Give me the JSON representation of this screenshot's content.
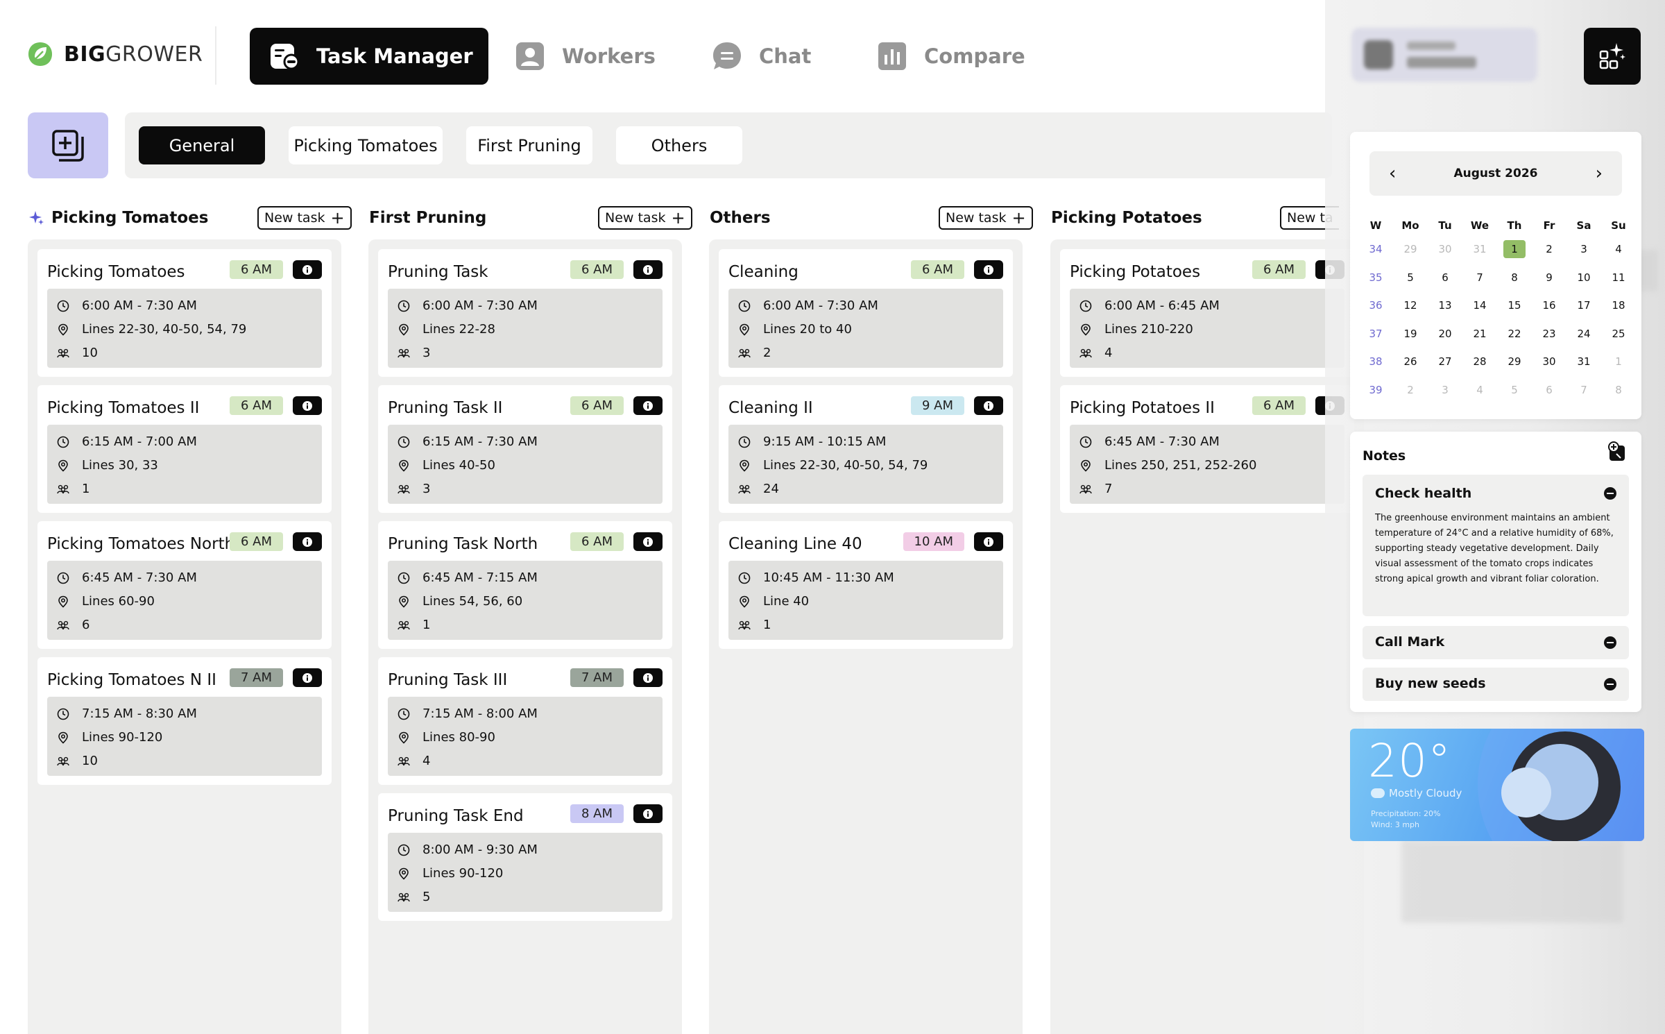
{
  "brand": {
    "bold": "BIG",
    "light": "GROWER"
  },
  "nav": [
    {
      "label": "Task Manager",
      "active": true
    },
    {
      "label": "Workers",
      "active": false
    },
    {
      "label": "Chat",
      "active": false
    },
    {
      "label": "Compare",
      "active": false
    }
  ],
  "tabs": [
    {
      "label": "General",
      "active": true
    },
    {
      "label": "Picking Tomatoes",
      "active": false
    },
    {
      "label": "First Pruning",
      "active": false
    },
    {
      "label": "Others",
      "active": false
    }
  ],
  "new_task_label": "New task",
  "new_task_label_cut": "New ta",
  "columns": [
    {
      "title": "Picking Tomatoes",
      "cards": [
        {
          "title": "Picking Tomatoes",
          "badge": "6 AM",
          "time": "6:00 AM - 7:30 AM",
          "lines": "Lines 22-30, 40-50, 54, 79",
          "workers": "10"
        },
        {
          "title": "Picking Tomatoes II",
          "badge": "6 AM",
          "time": "6:15 AM - 7:00 AM",
          "lines": "Lines 30, 33",
          "workers": "1"
        },
        {
          "title": "Picking Tomatoes North",
          "badge": "6 AM",
          "time": "6:45 AM - 7:30 AM",
          "lines": "Lines 60-90",
          "workers": "6"
        },
        {
          "title": "Picking Tomatoes N II",
          "badge": "7 AM",
          "time": "7:15 AM - 8:30 AM",
          "lines": "Lines 90-120",
          "workers": "10"
        }
      ]
    },
    {
      "title": "First Pruning",
      "cards": [
        {
          "title": "Pruning Task",
          "badge": "6 AM",
          "time": "6:00 AM - 7:30 AM",
          "lines": "Lines 22-28",
          "workers": "3"
        },
        {
          "title": "Pruning Task II",
          "badge": "6 AM",
          "time": "6:15 AM - 7:30 AM",
          "lines": "Lines 40-50",
          "workers": "3"
        },
        {
          "title": "Pruning Task North",
          "badge": "6 AM",
          "time": "6:45 AM - 7:15 AM",
          "lines": "Lines 54, 56, 60",
          "workers": "1"
        },
        {
          "title": "Pruning Task III",
          "badge": "7 AM",
          "time": "7:15 AM - 8:00 AM",
          "lines": "Lines 80-90",
          "workers": "4"
        },
        {
          "title": "Pruning Task End",
          "badge": "8 AM",
          "time": "8:00 AM - 9:30 AM",
          "lines": "Lines 90-120",
          "workers": "5"
        }
      ]
    },
    {
      "title": "Others",
      "cards": [
        {
          "title": "Cleaning",
          "badge": "6 AM",
          "time": "6:00 AM - 7:30 AM",
          "lines": "Lines 20 to 40",
          "workers": "2"
        },
        {
          "title": "Cleaning II",
          "badge": "9 AM",
          "time": "9:15 AM - 10:15 AM",
          "lines": "Lines 22-30, 40-50, 54, 79",
          "workers": "24"
        },
        {
          "title": "Cleaning Line 40",
          "badge": "10 AM",
          "time": "10:45 AM - 11:30 AM",
          "lines": "Line 40",
          "workers": "1"
        }
      ]
    },
    {
      "title": "Picking Potatoes",
      "cards": [
        {
          "title": "Picking Potatoes",
          "badge": "6 AM",
          "time": "6:00 AM - 6:45 AM",
          "lines": "Lines 210-220",
          "workers": "4"
        },
        {
          "title": "Picking Potatoes II",
          "badge": "6 AM",
          "time": "6:45 AM - 7:30 AM",
          "lines": "Lines 250, 251, 252-260",
          "workers": "7"
        }
      ]
    }
  ],
  "badge_colors": {
    "6 AM": "#d6e8c4",
    "7 AM": "#9aa59b",
    "8 AM": "#c9c8f4",
    "9 AM": "#cbe8f0",
    "10 AM": "#f2cde6"
  },
  "calendar": {
    "month": "August 2026",
    "headers": [
      "W",
      "Mo",
      "Tu",
      "We",
      "Th",
      "Fr",
      "Sa",
      "Su"
    ],
    "weeks": [
      {
        "wk": "34",
        "days": [
          "29",
          "30",
          "31",
          "1",
          "2",
          "3",
          "4"
        ],
        "muted": [
          0,
          1,
          2
        ]
      },
      {
        "wk": "35",
        "days": [
          "5",
          "6",
          "7",
          "8",
          "9",
          "10",
          "11"
        ],
        "muted": []
      },
      {
        "wk": "36",
        "days": [
          "12",
          "13",
          "14",
          "15",
          "16",
          "17",
          "18"
        ],
        "muted": []
      },
      {
        "wk": "37",
        "days": [
          "19",
          "20",
          "21",
          "22",
          "23",
          "24",
          "25"
        ],
        "muted": []
      },
      {
        "wk": "38",
        "days": [
          "26",
          "27",
          "28",
          "29",
          "30",
          "31",
          "1"
        ],
        "muted": [
          6
        ]
      },
      {
        "wk": "39",
        "days": [
          "2",
          "3",
          "4",
          "5",
          "6",
          "7",
          "8"
        ],
        "muted": [
          0,
          1,
          2,
          3,
          4,
          5,
          6
        ]
      }
    ],
    "today": {
      "week": 0,
      "day": 3
    }
  },
  "notes": {
    "title": "Notes",
    "items": [
      {
        "title": "Check health",
        "body": "The greenhouse environment maintains an ambient temperature of 24°C and a relative humidity of 68%, supporting steady vegetative development. Daily visual assessment of the tomato crops indicates strong apical growth and vibrant foliar coloration."
      },
      {
        "title": "Call Mark"
      },
      {
        "title": "Buy new seeds"
      }
    ]
  },
  "weather": {
    "temp": "20°",
    "condition": "Mostly Cloudy",
    "precipitation": "Precipitation: 20%",
    "wind": "Wind: 3 mph"
  },
  "colors": {
    "accent_dark": "#0b0b0b",
    "add_board_bg": "#c9c8f4",
    "brand_green": "#5aa84a",
    "today_green": "#93bd66",
    "week_number": "#6f6ad0"
  }
}
